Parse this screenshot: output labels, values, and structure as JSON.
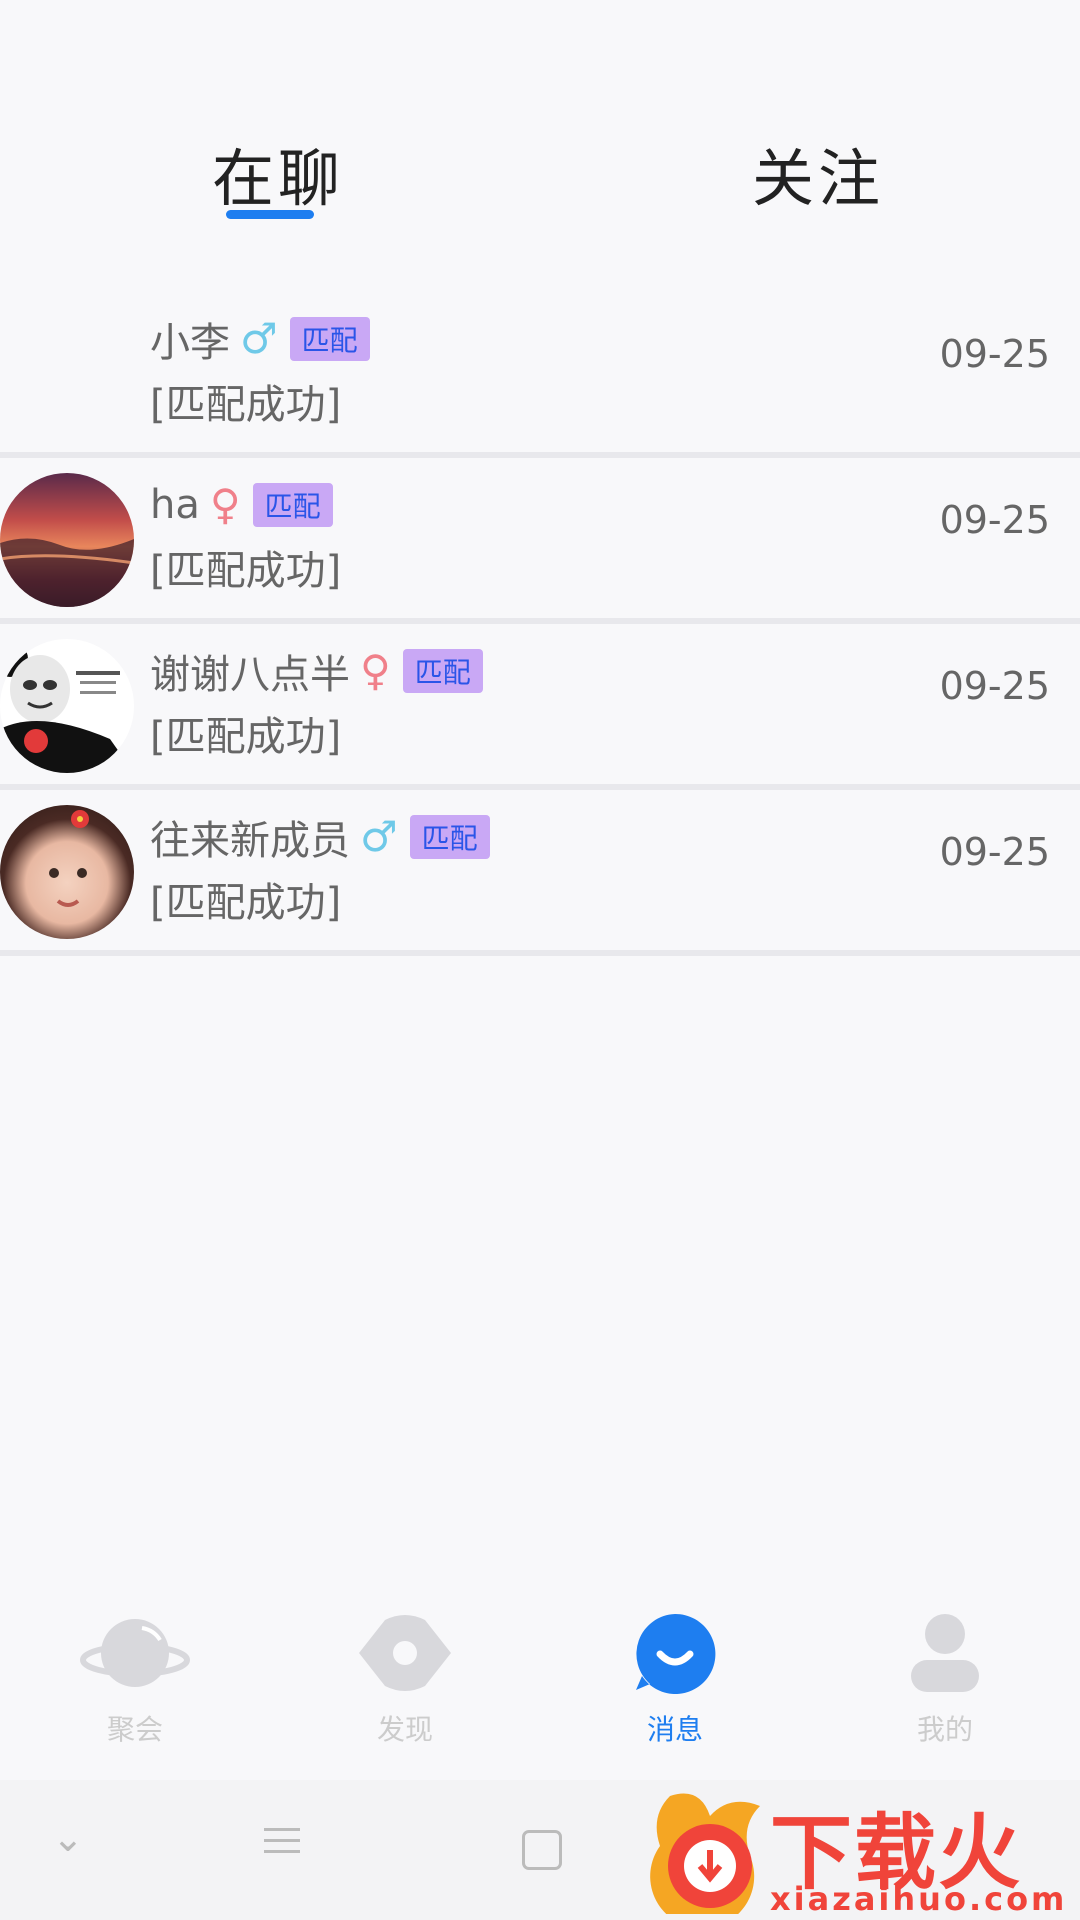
{
  "tabs": [
    {
      "label": "在聊",
      "active": true
    },
    {
      "label": "关注",
      "active": false
    }
  ],
  "conversations": [
    {
      "name": "小李",
      "gender": "male",
      "gender_symbol": "♂",
      "badge": "匹配",
      "preview": "[匹配成功]",
      "date": "09-25",
      "avatar": "none"
    },
    {
      "name": "ha",
      "gender": "female",
      "gender_symbol": "♀",
      "badge": "匹配",
      "preview": "[匹配成功]",
      "date": "09-25",
      "avatar": "sunset-photo"
    },
    {
      "name": "谢谢八点半",
      "gender": "female",
      "gender_symbol": "♀",
      "badge": "匹配",
      "preview": "[匹配成功]",
      "date": "09-25",
      "avatar": "panda-meme"
    },
    {
      "name": "往来新成员",
      "gender": "male",
      "gender_symbol": "♂",
      "badge": "匹配",
      "preview": "[匹配成功]",
      "date": "09-25",
      "avatar": "child-photo"
    }
  ],
  "bottom_nav": [
    {
      "label": "聚会",
      "icon": "planet-icon",
      "active": false
    },
    {
      "label": "发现",
      "icon": "eye-icon",
      "active": false
    },
    {
      "label": "消息",
      "icon": "message-bubble-icon",
      "active": true
    },
    {
      "label": "我的",
      "icon": "person-icon",
      "active": false
    }
  ],
  "colors": {
    "accent": "#1e7ef0",
    "badge_bg": "#c9a8f5",
    "badge_text": "#2a55e8",
    "male": "#6fc9e8",
    "female": "#f0808a",
    "watermark": "#f0443a"
  },
  "watermark": {
    "title": "下载火",
    "url": "xiazaihuo.com"
  }
}
